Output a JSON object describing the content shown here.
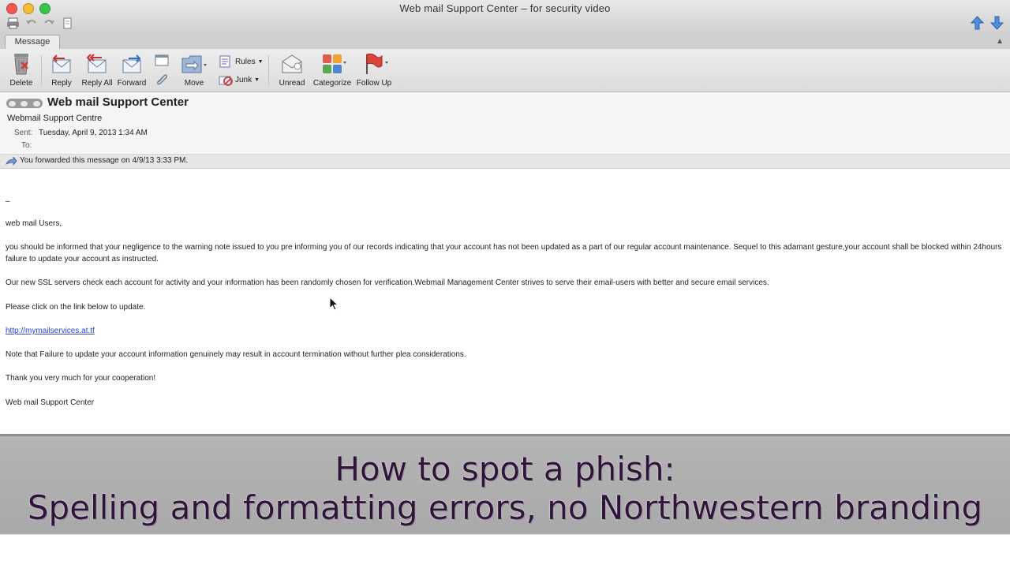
{
  "window": {
    "title": "Web mail Support Center – for security video"
  },
  "ribbon": {
    "tab": "Message",
    "buttons": {
      "delete": "Delete",
      "reply": "Reply",
      "reply_all": "Reply All",
      "forward": "Forward",
      "move": "Move",
      "rules": "Rules",
      "junk": "Junk",
      "unread": "Unread",
      "categorize": "Categorize",
      "follow_up": "Follow Up"
    }
  },
  "message": {
    "subject": "Web mail Support Center",
    "from": "Webmail Support Centre",
    "sent_label": "Sent:",
    "sent_value": "Tuesday, April 9, 2013 1:34 AM",
    "to_label": "To:",
    "info": "You forwarded this message on 4/9/13 3:33 PM.",
    "body": {
      "dash": "–",
      "greeting": "web mail Users,",
      "p1": "you should be informed that your negligence to the warning note issued to you pre informing you of our records indicating that your account has not been updated as a part of our regular account maintenance. Sequel to this adamant gesture,your account shall be blocked within 24hours failure to update your account as instructed.",
      "p2": "Our new SSL servers check each account for activity and your information has been randomly chosen for verification.Webmail Management Center strives to serve their email-users with better and secure email services.",
      "p3": "Please click on the link below to update.",
      "link": "http://mymailservices.at.tf",
      "p4": "Note that Failure to update your account information genuinely may result in account termination without further plea considerations.",
      "p5": "Thank you very much for your cooperation!",
      "signature": "Web mail Support Center"
    }
  },
  "caption": {
    "line1": "How to spot a phish:",
    "line2": "Spelling and formatting errors, no Northwestern branding"
  },
  "colors": {
    "caption_text": "#2f1538",
    "link": "#2a44c9",
    "follow_up_flag": "#d9463b"
  }
}
